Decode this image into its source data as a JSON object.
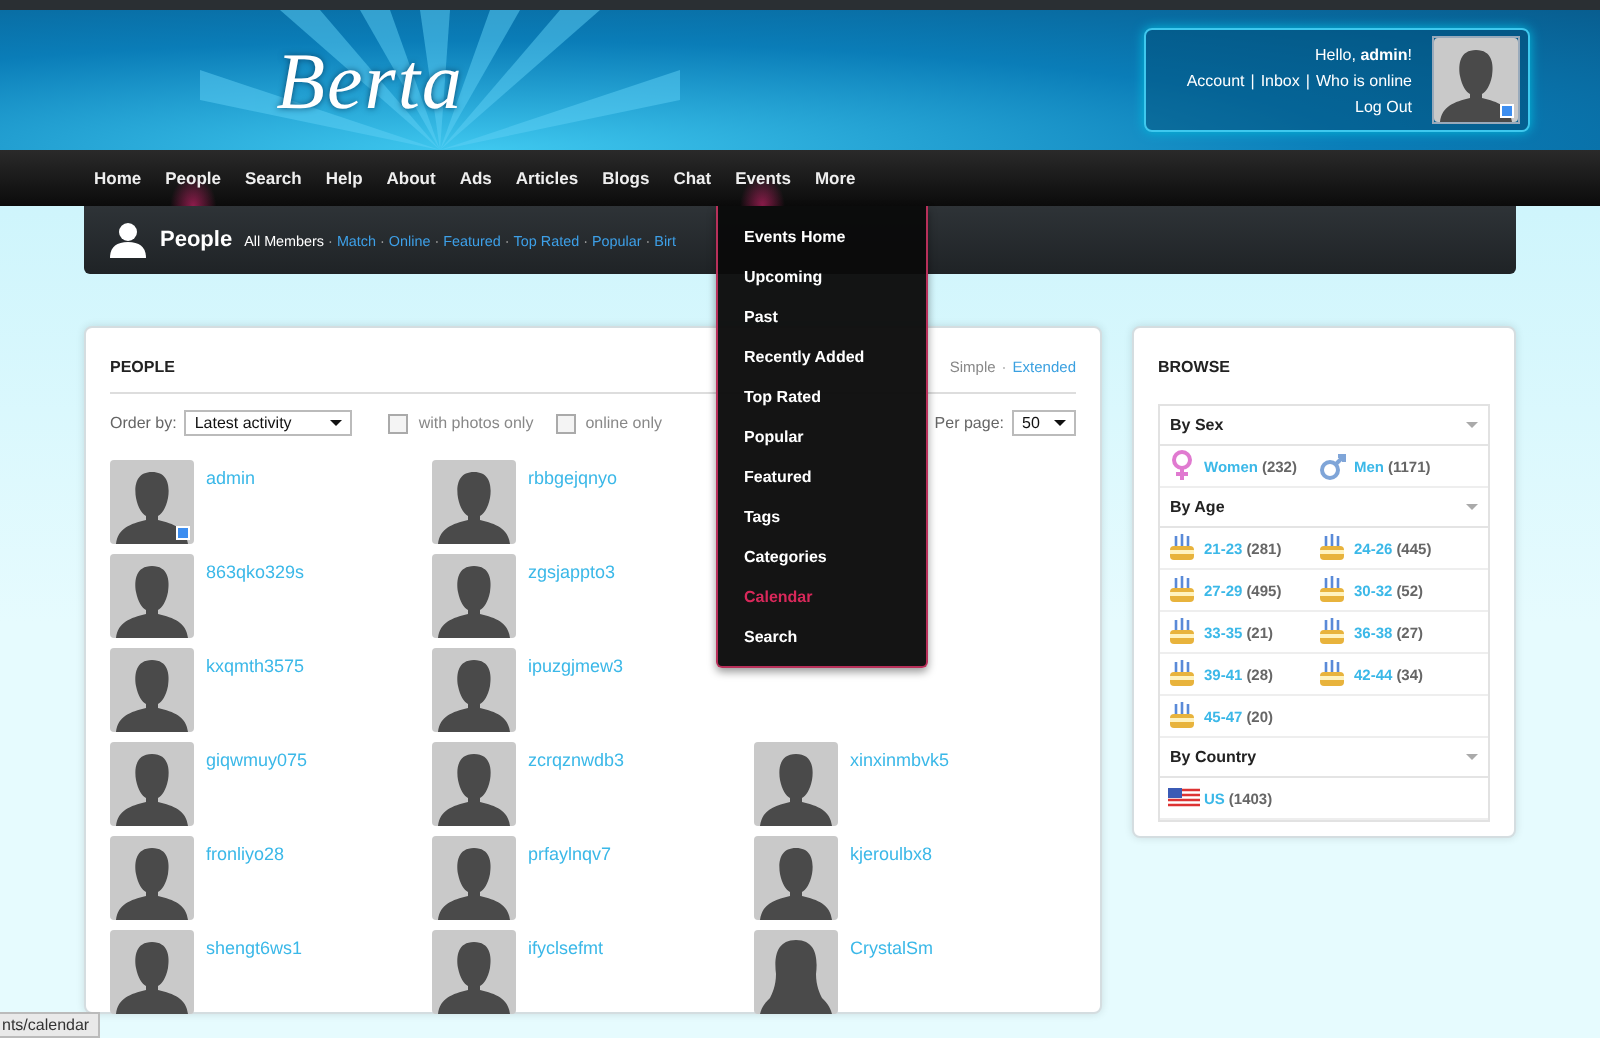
{
  "header": {
    "logo": "Berta",
    "user_box": {
      "greeting": "Hello, ",
      "username": "admin",
      "greeting_end": "!",
      "links": [
        "Account",
        "Inbox",
        "Who is online"
      ],
      "separator": "|",
      "logout": "Log Out",
      "online": true
    }
  },
  "nav": {
    "items": [
      {
        "label": "Home",
        "selected": false
      },
      {
        "label": "People",
        "selected": true
      },
      {
        "label": "Search",
        "selected": false
      },
      {
        "label": "Help",
        "selected": false
      },
      {
        "label": "About",
        "selected": false
      },
      {
        "label": "Ads",
        "selected": false
      },
      {
        "label": "Articles",
        "selected": false
      },
      {
        "label": "Blogs",
        "selected": false
      },
      {
        "label": "Chat",
        "selected": false
      },
      {
        "label": "Events",
        "selected": true
      },
      {
        "label": "More",
        "selected": false
      }
    ]
  },
  "subnav": {
    "title": "People",
    "links": [
      {
        "label": "All Members",
        "selected": true
      },
      {
        "label": "Match",
        "selected": false
      },
      {
        "label": "Online",
        "selected": false
      },
      {
        "label": "Featured",
        "selected": false
      },
      {
        "label": "Top Rated",
        "selected": false
      },
      {
        "label": "Popular",
        "selected": false
      },
      {
        "label": "Birt",
        "selected": false
      }
    ],
    "separator": "·"
  },
  "events_menu": {
    "items": [
      {
        "label": "Events Home",
        "selected": false
      },
      {
        "label": "Upcoming",
        "selected": false
      },
      {
        "label": "Past",
        "selected": false
      },
      {
        "label": "Recently Added",
        "selected": false
      },
      {
        "label": "Top Rated",
        "selected": false
      },
      {
        "label": "Popular",
        "selected": false
      },
      {
        "label": "Featured",
        "selected": false
      },
      {
        "label": "Tags",
        "selected": false
      },
      {
        "label": "Categories",
        "selected": false
      },
      {
        "label": "Calendar",
        "selected": true
      },
      {
        "label": "Search",
        "selected": false
      }
    ]
  },
  "people_panel": {
    "title": "PEOPLE",
    "views": [
      {
        "label": "Simple",
        "selected": true
      },
      {
        "label": "Extended",
        "selected": false
      }
    ],
    "view_separator": "·",
    "order_label": "Order by:",
    "order_value": "Latest activity",
    "filters": [
      {
        "label": "with photos only",
        "checked": false
      },
      {
        "label": "online only",
        "checked": false
      }
    ],
    "per_page_label": "Per page:",
    "per_page_value": "50",
    "people": [
      {
        "name": "admin",
        "kind": "male",
        "online": true
      },
      {
        "name": "rbbgejqnyo",
        "kind": "male",
        "online": false
      },
      {
        "kind": "hidden"
      },
      {
        "name": "863qko329s",
        "kind": "male",
        "online": false
      },
      {
        "name": "zgsjappto3",
        "kind": "male",
        "online": false
      },
      {
        "kind": "hidden"
      },
      {
        "name": "kxqmth3575",
        "kind": "male",
        "online": false
      },
      {
        "name": "ipuzgjmew3",
        "kind": "male",
        "online": false
      },
      {
        "kind": "hidden"
      },
      {
        "name": "giqwmuy075",
        "kind": "male",
        "online": false
      },
      {
        "name": "zcrqznwdb3",
        "kind": "male",
        "online": false
      },
      {
        "name": "xinxinmbvk5",
        "kind": "male",
        "online": false
      },
      {
        "name": "fronliyo28",
        "kind": "male",
        "online": false
      },
      {
        "name": "prfaylnqv7",
        "kind": "male",
        "online": false
      },
      {
        "name": "kjeroulbx8",
        "kind": "male",
        "online": false
      },
      {
        "name": "shengt6ws1",
        "kind": "male",
        "online": false
      },
      {
        "name": "ifyclsefmt",
        "kind": "male",
        "online": false
      },
      {
        "name": "CrystalSm",
        "kind": "female",
        "online": false
      }
    ]
  },
  "browse": {
    "title": "BROWSE",
    "sections": [
      {
        "title": "By Sex",
        "items": [
          {
            "kind": "female",
            "label": "Women",
            "count": "(232)"
          },
          {
            "kind": "male",
            "label": "Men",
            "count": "(1171)"
          }
        ]
      },
      {
        "title": "By Age",
        "items": [
          {
            "kind": "cake",
            "label": "21-23",
            "count": "(281)"
          },
          {
            "kind": "cake",
            "label": "24-26",
            "count": "(445)"
          },
          {
            "kind": "cake",
            "label": "27-29",
            "count": "(495)"
          },
          {
            "kind": "cake",
            "label": "30-32",
            "count": "(52)"
          },
          {
            "kind": "cake",
            "label": "33-35",
            "count": "(21)"
          },
          {
            "kind": "cake",
            "label": "36-38",
            "count": "(27)"
          },
          {
            "kind": "cake",
            "label": "39-41",
            "count": "(28)"
          },
          {
            "kind": "cake",
            "label": "42-44",
            "count": "(34)"
          },
          {
            "kind": "cake",
            "label": "45-47",
            "count": "(20)"
          }
        ]
      },
      {
        "title": "By Country",
        "items": [
          {
            "kind": "flag",
            "label": "US",
            "count": "(1403)"
          }
        ]
      }
    ]
  },
  "status_bar": "nts/calendar"
}
